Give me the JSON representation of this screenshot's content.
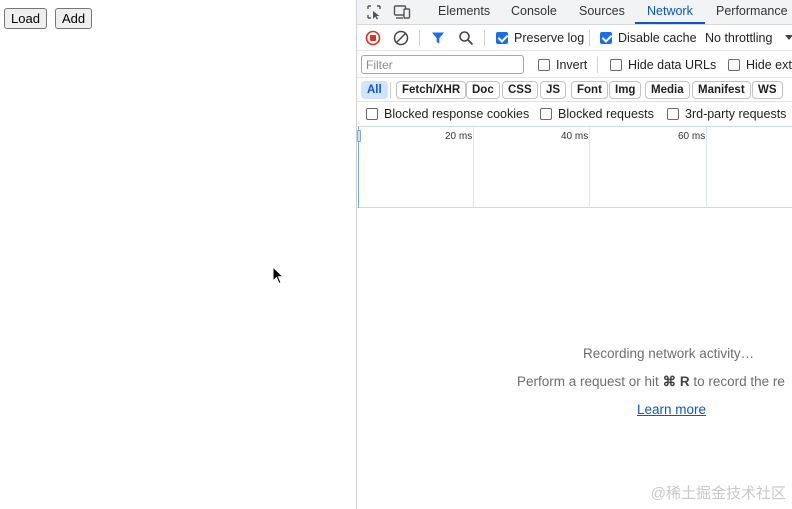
{
  "page": {
    "load_button": "Load",
    "add_button": "Add"
  },
  "devtools": {
    "tabs": [
      "Elements",
      "Console",
      "Sources",
      "Network",
      "Performance"
    ],
    "active_tab": "Network",
    "toolbar": {
      "preserve_log": "Preserve log",
      "disable_cache": "Disable cache",
      "throttling": "No throttling"
    },
    "filter_bar": {
      "filter_placeholder": "Filter",
      "invert": "Invert",
      "hide_data_urls": "Hide data URLs",
      "hide_extension": "Hide exte"
    },
    "chips": [
      "All",
      "Fetch/XHR",
      "Doc",
      "CSS",
      "JS",
      "Font",
      "Img",
      "Media",
      "Manifest",
      "WS"
    ],
    "row4": {
      "blocked_cookies": "Blocked response cookies",
      "blocked_requests": "Blocked requests",
      "third_party": "3rd-party requests"
    },
    "timeline_ticks": [
      "20 ms",
      "40 ms",
      "60 ms"
    ],
    "empty_state": {
      "recording": "Recording network activity…",
      "perform_prefix": "Perform a request or hit ",
      "shortcut": "⌘ R",
      "perform_suffix": " to record the re",
      "learn_more": "Learn more"
    },
    "watermark": "@稀土掘金技术社区",
    "colors": {
      "accent": "#0b57d0",
      "record_stop": "#d93025",
      "checkbox": "#1a6fe6"
    }
  }
}
